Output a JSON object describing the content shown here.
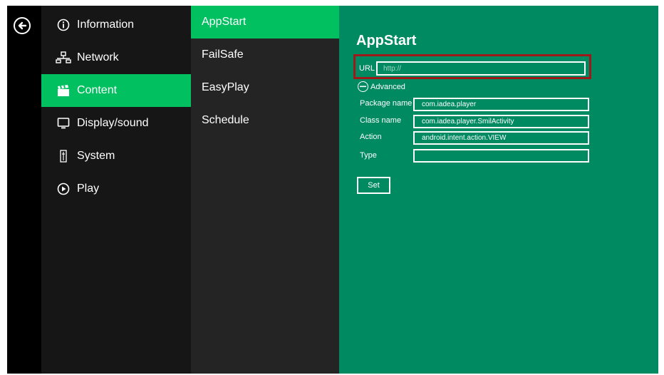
{
  "nav": {
    "back_icon": "back-arrow-circle-icon"
  },
  "menu": {
    "items": [
      {
        "label": "Information",
        "icon": "info-icon"
      },
      {
        "label": "Network",
        "icon": "network-icon"
      },
      {
        "label": "Content",
        "icon": "clapperboard-icon",
        "active": true
      },
      {
        "label": "Display/sound",
        "icon": "monitor-icon"
      },
      {
        "label": "System",
        "icon": "system-icon"
      },
      {
        "label": "Play",
        "icon": "play-icon"
      }
    ]
  },
  "submenu": {
    "items": [
      {
        "label": "AppStart",
        "active": true
      },
      {
        "label": "FailSafe"
      },
      {
        "label": "EasyPlay"
      },
      {
        "label": "Schedule"
      }
    ]
  },
  "panel": {
    "title": "AppStart",
    "url_label": "URL",
    "url_value": "",
    "url_placeholder": "http://",
    "advanced_label": "Advanced",
    "fields": [
      {
        "label": "Package name",
        "value": "com.iadea.player"
      },
      {
        "label": "Class name",
        "value": "com.iadea.player.SmilActivity"
      },
      {
        "label": "Action",
        "value": "android.intent.action.VIEW"
      },
      {
        "label": "Type",
        "value": ""
      }
    ],
    "set_label": "Set"
  },
  "colors": {
    "accent": "#00c060",
    "panel": "#008a62",
    "highlight": "#9e1a1a",
    "menu_bg": "#161616",
    "submenu_bg": "#242424"
  }
}
